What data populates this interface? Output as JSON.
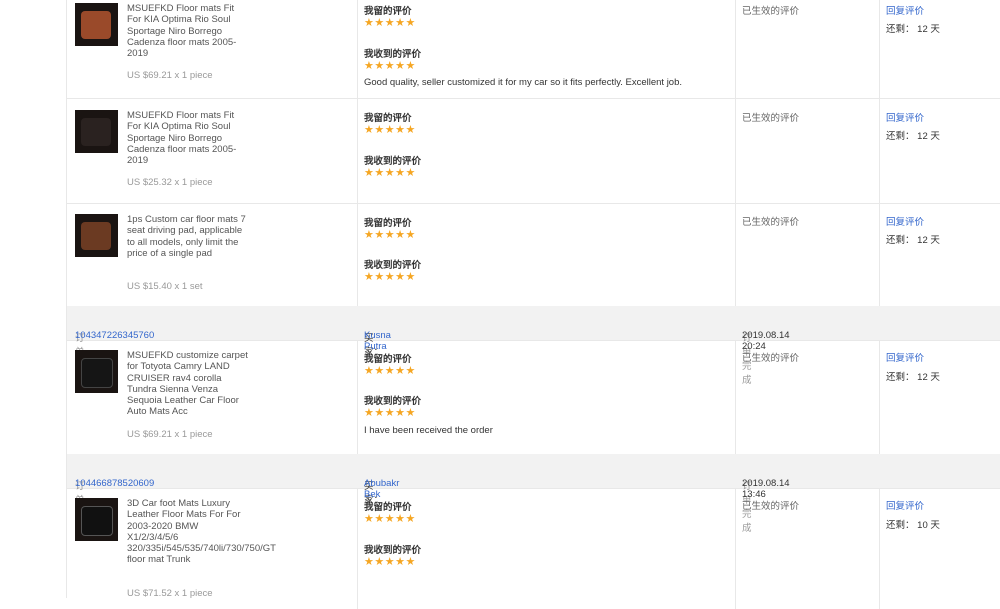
{
  "labels": {
    "my_review": "我留的评价",
    "received_review": "我收到的评价",
    "status": "已生效的评价",
    "reply": "回复评价",
    "remaining": "还剩：",
    "order_no": "订单号",
    "buyer": "买家：",
    "order_done": "订单完成"
  },
  "stars": "★★★★★",
  "items": [
    {
      "title": "MSUEFKD Floor mats Fit For KIA Optima Rio Soul Sportage Niro Borrego Cadenza floor mats 2005-2019",
      "price": "US $69.21 x 1 piece",
      "feedback": "Good quality, seller customized it for my car so it fits perfectly. Excellent job.",
      "days": "12 天"
    },
    {
      "title": "MSUEFKD Floor mats Fit For KIA Optima Rio Soul Sportage Niro Borrego Cadenza floor mats 2005-2019",
      "price": "US $25.32 x 1 piece",
      "feedback": "",
      "days": "12 天"
    },
    {
      "title": "1ps Custom car floor mats 7 seat driving pad, applicable to all models, only limit the price of a single pad",
      "price": "US $15.40 x 1 set",
      "feedback": "",
      "days": "12 天"
    }
  ],
  "orders": [
    {
      "order_id": "104347226345760",
      "buyer": "Kusna Putra",
      "completed": "2019.08.14 20:24",
      "item": {
        "title": "MSUEFKD customize carpet for Totyota Camry LAND CRUISER rav4 corolla Tundra Sienna Venza Sequoia Leather Car Floor Auto Mats Acc",
        "price": "US $69.21 x 1 piece",
        "feedback": "I have been received the order",
        "days": "12 天"
      }
    },
    {
      "order_id": "104466878520609",
      "buyer": "Abubakr Bek",
      "completed": "2019.08.14 13:46",
      "item": {
        "title": "3D Car foot Mats Luxury Leather Floor Mats For For 2003-2020 BMW X1/2/3/4/5/6 320/335i/545/535/740li/730/750/GT floor mat Trunk",
        "price": "US $71.52 x 1 piece",
        "feedback": "",
        "days": "10 天"
      }
    }
  ],
  "colors": {
    "link": "#3366cc",
    "star": "#f5a623",
    "header_bg": "#f2f2f2"
  }
}
